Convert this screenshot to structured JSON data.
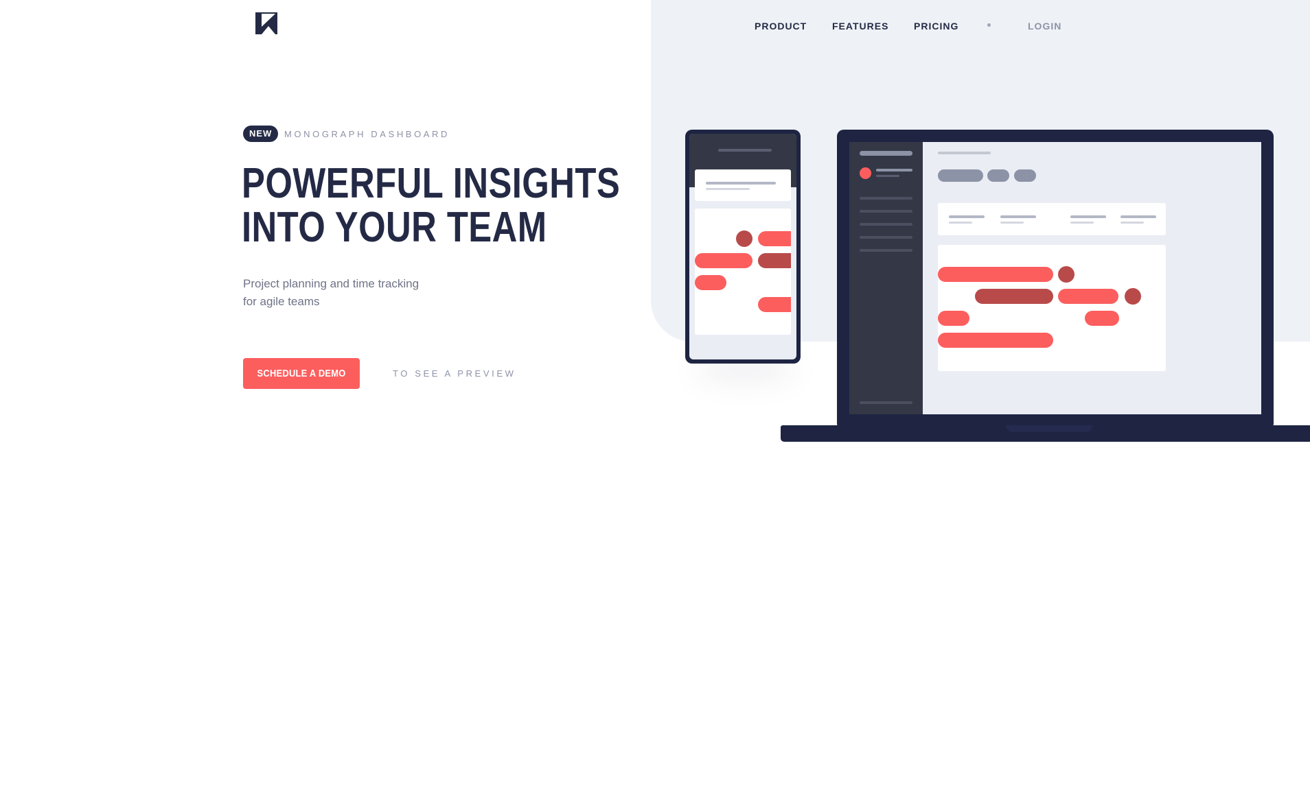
{
  "nav": {
    "items": [
      {
        "label": "PRODUCT"
      },
      {
        "label": "FEATURES"
      },
      {
        "label": "PRICING"
      }
    ],
    "login_label": "LOGIN"
  },
  "brand": {
    "logo_icon": "monograph-logo-icon"
  },
  "hero": {
    "badge": "NEW",
    "badge_label": "MONOGRAPH DASHBOARD",
    "headline_line1": "POWERFUL INSIGHTS",
    "headline_line2": "INTO YOUR TEAM",
    "subtitle_line1": "Project planning and time tracking",
    "subtitle_line2": "for agile teams",
    "cta_label": "SCHEDULE A DEMO",
    "preview_label": "TO SEE A PREVIEW"
  },
  "colors": {
    "navy": "#242a45",
    "coral": "#fc5e5e",
    "coral_dark": "#b94a4a",
    "panel": "#eef2f6",
    "muted": "#8d93a6"
  }
}
